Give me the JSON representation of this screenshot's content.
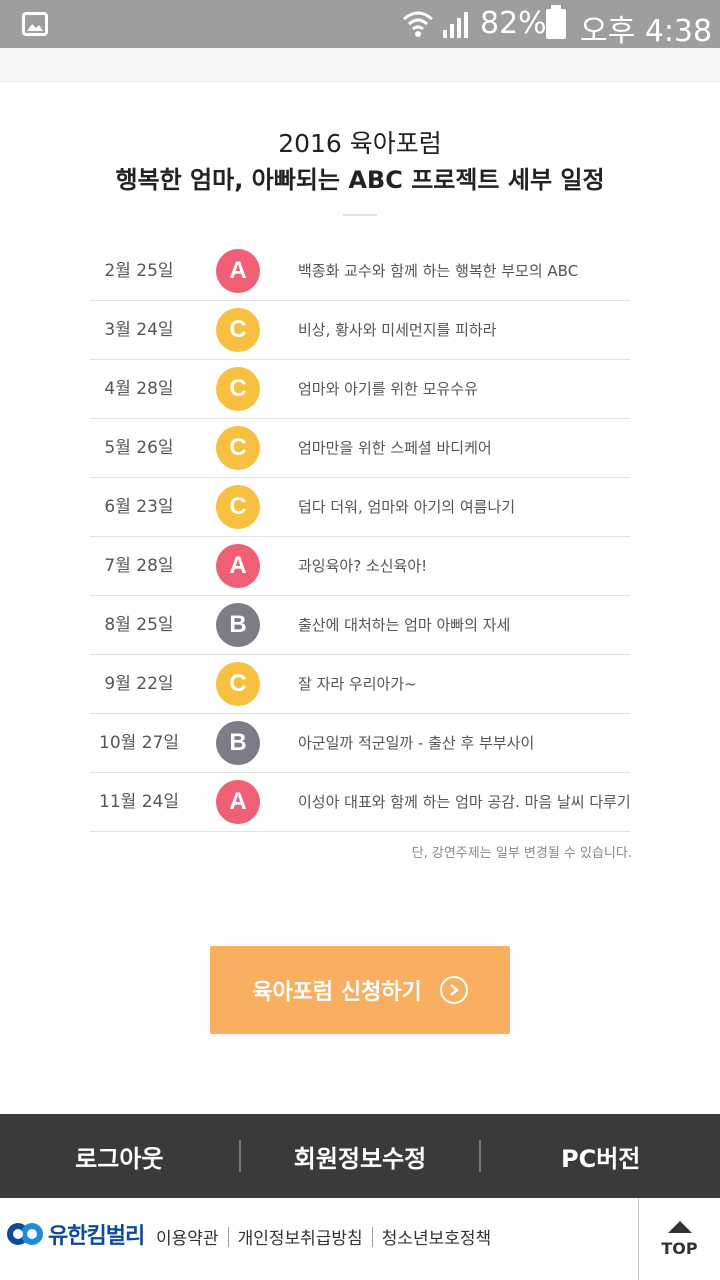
{
  "status_bar": {
    "battery": "82%",
    "time": "오후 4:38"
  },
  "title": {
    "line1": "2016 육아포럼",
    "line2": "행복한 엄마, 아빠되는 ABC 프로젝트 세부 일정"
  },
  "schedule": [
    {
      "date": "2월 25일",
      "badge": "A",
      "topic": "백종화 교수와 함께 하는 행복한 부모의 ABC"
    },
    {
      "date": "3월 24일",
      "badge": "C",
      "topic": "비상, 황사와 미세먼지를 피하라"
    },
    {
      "date": "4월 28일",
      "badge": "C",
      "topic": "엄마와 아기를 위한 모유수유"
    },
    {
      "date": "5월 26일",
      "badge": "C",
      "topic": "엄마만을 위한 스페셜 바디케어"
    },
    {
      "date": "6월 23일",
      "badge": "C",
      "topic": "덥다 더워, 엄마와 아기의 여름나기"
    },
    {
      "date": "7월 28일",
      "badge": "A",
      "topic": "과잉육아? 소신육아!"
    },
    {
      "date": "8월 25일",
      "badge": "B",
      "topic": "출산에 대처하는 엄마 아빠의 자세"
    },
    {
      "date": "9월  22일",
      "badge": "C",
      "topic": "잘 자라 우리아가~"
    },
    {
      "date": "10월 27일",
      "badge": "B",
      "topic": "아군일까 적군일까 - 출산 후 부부사이"
    },
    {
      "date": "11월 24일",
      "badge": "A",
      "topic": "이성아 대표와 함께 하는 엄마 공감. 마음 날씨 다루기"
    }
  ],
  "badge_colors": {
    "A": "#ef6077",
    "B": "#7f7b88",
    "C": "#f8c040"
  },
  "note": "단, 강연주제는 일부 변경될 수 있습니다.",
  "cta": {
    "label": "육아포럼 신청하기"
  },
  "footer_nav": {
    "logout": "로그아웃",
    "edit_profile": "회원정보수정",
    "pc_version": "PC버전"
  },
  "bottom_bar": {
    "brand": "유한킴벌리",
    "links": [
      "이용약관",
      "개인정보취급방침",
      "청소년보호정책"
    ],
    "top_label": "TOP"
  }
}
